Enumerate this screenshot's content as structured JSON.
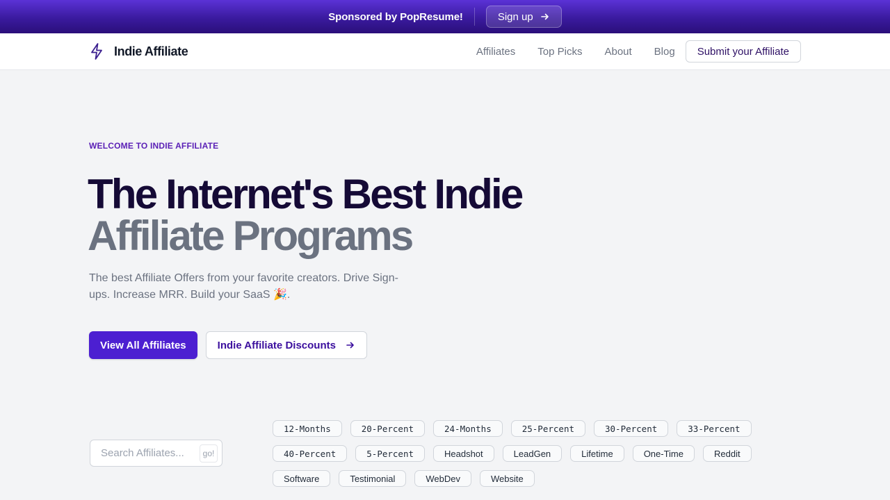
{
  "sponsor": {
    "text": "Sponsored by PopResume!",
    "signup_label": "Sign up",
    "signup_icon": "arrow-right-icon"
  },
  "nav": {
    "logo_icon": "lightning-bolt-icon",
    "logo_text": "Indie Affiliate",
    "links": [
      "Affiliates",
      "Top Picks",
      "About",
      "Blog"
    ],
    "submit_label": "Submit your Affiliate"
  },
  "hero": {
    "eyebrow": "WELCOME TO INDIE AFFILIATE",
    "title_line1": "The Internet's Best Indie",
    "title_line2": "Affiliate Programs",
    "subtitle": "The best Affiliate Offers from your favorite creators. Drive Sign-ups. Increase MRR. Build your SaaS 🎉.",
    "primary_cta": "View All Affiliates",
    "secondary_cta": "Indie Affiliate Discounts",
    "secondary_cta_icon": "arrow-right-icon"
  },
  "search": {
    "placeholder": "Search Affiliates...",
    "value": "",
    "go_label": "go!"
  },
  "tags": {
    "row1": [
      "12-Months",
      "20-Percent",
      "24-Months",
      "25-Percent",
      "30-Percent",
      "33-Percent"
    ],
    "row2": [
      "40-Percent",
      "5-Percent",
      "Headshot",
      "LeadGen",
      "Lifetime",
      "One-Time",
      "Reddit"
    ],
    "row3": [
      "Software",
      "Testimonial",
      "WebDev",
      "Website"
    ]
  },
  "colors": {
    "accent": "#4c1fd1",
    "sponsor_gradient_top": "#5b32d6",
    "sponsor_gradient_bottom": "#2a0f7a",
    "title_dark": "#150a36",
    "title_muted": "#6b7280",
    "background": "#f3f4f6"
  }
}
